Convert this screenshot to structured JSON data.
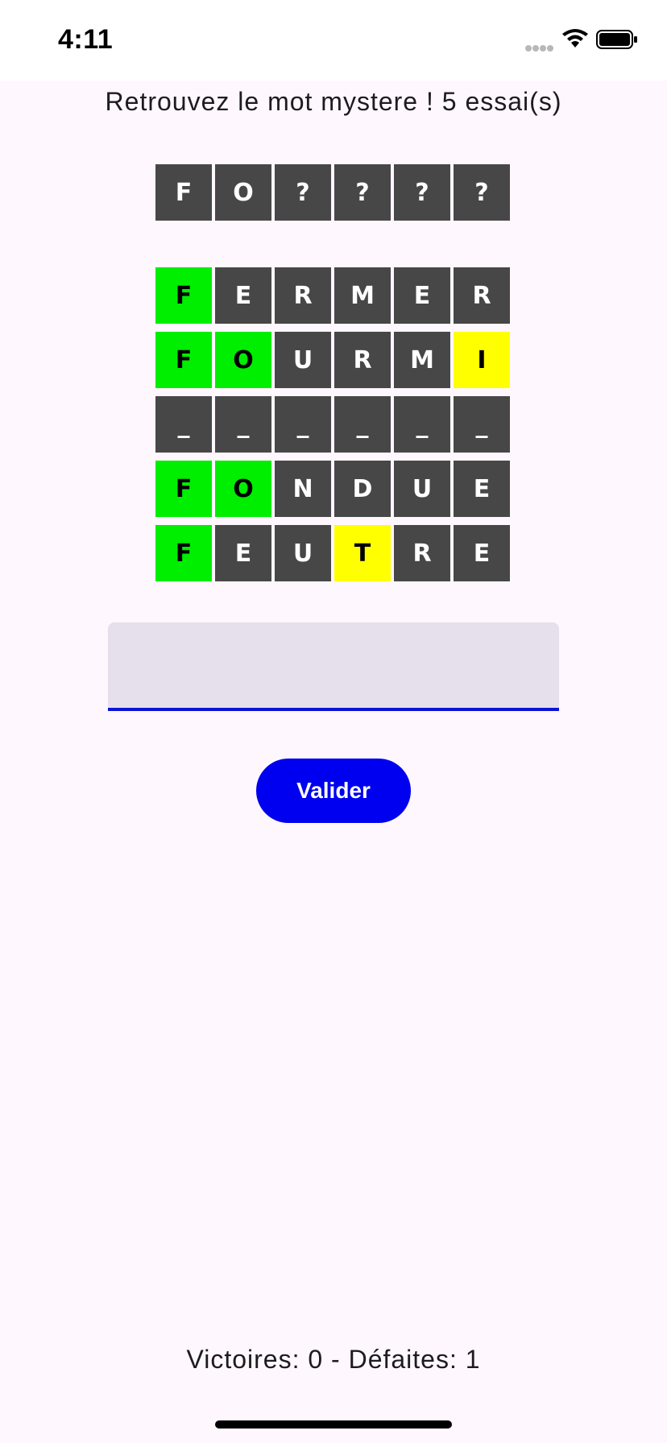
{
  "status_bar": {
    "time": "4:11"
  },
  "title": "Retrouvez le mot mystere ! 5 essai(s)",
  "mystery_word": [
    "F",
    "O",
    "?",
    "?",
    "?",
    "?"
  ],
  "guesses": [
    [
      {
        "letter": "F",
        "state": "correct"
      },
      {
        "letter": "E",
        "state": "absent"
      },
      {
        "letter": "R",
        "state": "absent"
      },
      {
        "letter": "M",
        "state": "absent"
      },
      {
        "letter": "E",
        "state": "absent"
      },
      {
        "letter": "R",
        "state": "absent"
      }
    ],
    [
      {
        "letter": "F",
        "state": "correct"
      },
      {
        "letter": "O",
        "state": "correct"
      },
      {
        "letter": "U",
        "state": "absent"
      },
      {
        "letter": "R",
        "state": "absent"
      },
      {
        "letter": "M",
        "state": "absent"
      },
      {
        "letter": "I",
        "state": "present"
      }
    ],
    [
      {
        "letter": "_",
        "state": "absent"
      },
      {
        "letter": "_",
        "state": "absent"
      },
      {
        "letter": "_",
        "state": "absent"
      },
      {
        "letter": "_",
        "state": "absent"
      },
      {
        "letter": "_",
        "state": "absent"
      },
      {
        "letter": "_",
        "state": "absent"
      }
    ],
    [
      {
        "letter": "F",
        "state": "correct"
      },
      {
        "letter": "O",
        "state": "correct"
      },
      {
        "letter": "N",
        "state": "absent"
      },
      {
        "letter": "D",
        "state": "absent"
      },
      {
        "letter": "U",
        "state": "absent"
      },
      {
        "letter": "E",
        "state": "absent"
      }
    ],
    [
      {
        "letter": "F",
        "state": "correct"
      },
      {
        "letter": "E",
        "state": "absent"
      },
      {
        "letter": "U",
        "state": "absent"
      },
      {
        "letter": "T",
        "state": "present"
      },
      {
        "letter": "R",
        "state": "absent"
      },
      {
        "letter": "E",
        "state": "absent"
      }
    ]
  ],
  "input": {
    "value": "",
    "placeholder": ""
  },
  "validate_button": {
    "label": "Valider"
  },
  "score": "Victoires: 0 - Défaites: 1",
  "colors": {
    "tile_absent": "#474747",
    "tile_correct": "#00ee00",
    "tile_present": "#ffff00",
    "accent": "#0000f0",
    "background": "#fef7fd"
  }
}
